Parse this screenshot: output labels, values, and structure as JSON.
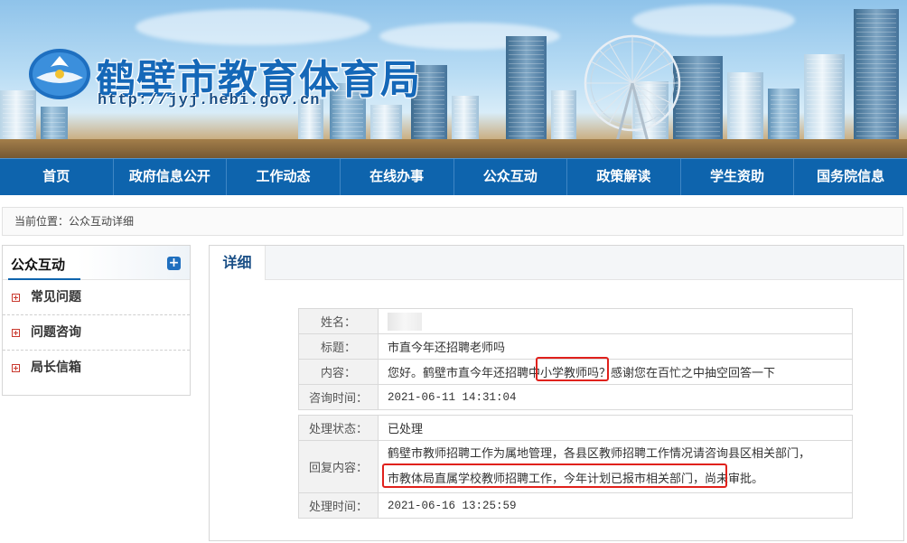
{
  "site": {
    "title": "鹤壁市教育体育局",
    "url": "http://jyj.hebi.gov.cn"
  },
  "nav": [
    "首页",
    "政府信息公开",
    "工作动态",
    "在线办事",
    "公众互动",
    "政策解读",
    "学生资助",
    "国务院信息"
  ],
  "breadcrumb": "当前位置：公众互动详细",
  "sidebar": {
    "title": "公众互动",
    "expand_icon": "plus-icon",
    "items": [
      "常见问题",
      "问题咨询",
      "局长信箱"
    ]
  },
  "detail": {
    "tab": "详细",
    "rows": {
      "name_label": "姓名：",
      "title_label": "标题：",
      "title_value": "市直今年还招聘老师吗",
      "content_label": "内容：",
      "content_value": "您好。鹤壁市直今年还招聘中小学教师吗？感谢您在百忙之中抽空回答一下",
      "ask_time_label": "咨询时间：",
      "ask_time_value": "2021-06-11 14:31:04",
      "status_label": "处理状态：",
      "status_value": "已处理",
      "reply_label": "回复内容：",
      "reply_line1": "鹤壁市教师招聘工作为属地管理，各县区教师招聘工作情况请咨询县区相关部门，",
      "reply_line2": "市教体局直属学校教师招聘工作，今年计划已报市相关部门，尚未审批。",
      "handle_time_label": "处理时间：",
      "handle_time_value": "2021-06-16 13:25:59"
    }
  },
  "colors": {
    "nav_bg": "#0e64ad",
    "title_blue": "#1568b8",
    "highlight_red": "#e0211c"
  }
}
